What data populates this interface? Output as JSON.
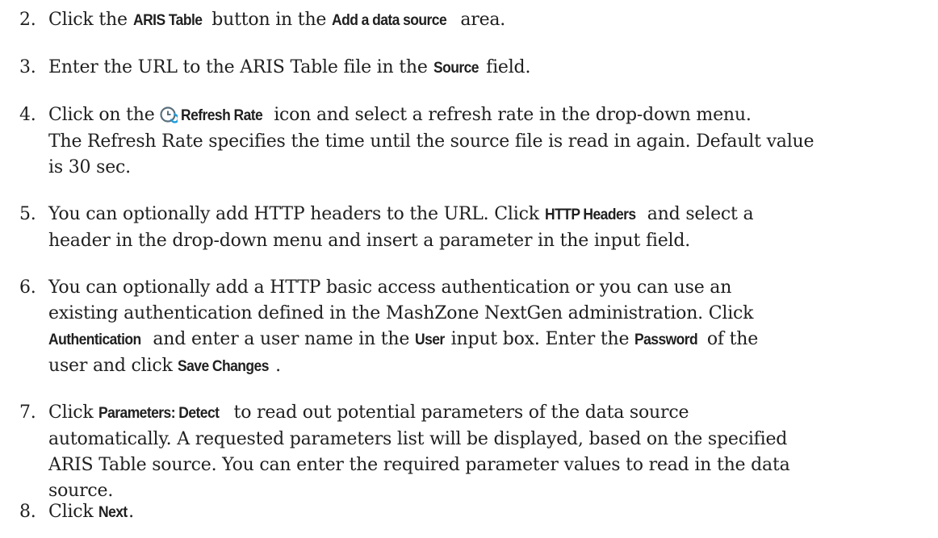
{
  "steps": [
    {
      "num": "2.",
      "parts": [
        {
          "t": "text",
          "v": "Click the "
        },
        {
          "t": "ui",
          "v": "ARIS Table"
        },
        {
          "t": "text",
          "v": " button in the "
        },
        {
          "t": "ui",
          "v": "Add a data source"
        },
        {
          "t": "text",
          "v": " area."
        }
      ]
    },
    {
      "num": "3.",
      "parts": [
        {
          "t": "text",
          "v": "Enter the URL to the ARIS Table file in the "
        },
        {
          "t": "ui",
          "v": "Source"
        },
        {
          "t": "text",
          "v": " field."
        }
      ]
    },
    {
      "num": "4.",
      "parts": [
        {
          "t": "text",
          "v": "Click on the "
        },
        {
          "t": "icon",
          "v": "refresh-rate-icon"
        },
        {
          "t": "ui",
          "v": "Refresh Rate"
        },
        {
          "t": "text",
          "v": " icon and select a refresh rate in the drop-down menu."
        },
        {
          "t": "br"
        },
        {
          "t": "text",
          "v": "The Refresh Rate specifies the time until the source file is read in again. Default value"
        },
        {
          "t": "br"
        },
        {
          "t": "text",
          "v": "is 30 sec."
        }
      ]
    },
    {
      "num": "5.",
      "parts": [
        {
          "t": "text",
          "v": "You can optionally add HTTP headers to the URL. Click "
        },
        {
          "t": "ui",
          "v": "HTTP Headers"
        },
        {
          "t": "text",
          "v": " and select a"
        },
        {
          "t": "br"
        },
        {
          "t": "text",
          "v": "header in the drop-down menu and insert a parameter in the input field."
        }
      ]
    },
    {
      "num": "6.",
      "parts": [
        {
          "t": "text",
          "v": "You can optionally add a HTTP basic access authentication or you can use an"
        },
        {
          "t": "br"
        },
        {
          "t": "text",
          "v": "existing authentication defined in the MashZone NextGen administration. Click"
        },
        {
          "t": "br"
        },
        {
          "t": "ui",
          "v": "Authentication"
        },
        {
          "t": "text",
          "v": " and enter a user name in the "
        },
        {
          "t": "ui",
          "v": "User"
        },
        {
          "t": "text",
          "v": " input box. Enter the "
        },
        {
          "t": "ui",
          "v": "Password"
        },
        {
          "t": "text",
          "v": " of the"
        },
        {
          "t": "br"
        },
        {
          "t": "text",
          "v": "user and click "
        },
        {
          "t": "ui",
          "v": "Save Changes"
        },
        {
          "t": "text",
          "v": "."
        }
      ]
    },
    {
      "num": "7.",
      "parts": [
        {
          "t": "text",
          "v": "Click "
        },
        {
          "t": "ui",
          "v": "Parameters: Detect"
        },
        {
          "t": "text",
          "v": " to read out potential parameters of the data source"
        },
        {
          "t": "br"
        },
        {
          "t": "text",
          "v": "automatically. A requested parameters list will be displayed, based on the specified"
        },
        {
          "t": "br"
        },
        {
          "t": "text",
          "v": "ARIS Table source. You can enter the required parameter values to read in the data"
        },
        {
          "t": "br"
        },
        {
          "t": "text",
          "v": "source."
        }
      ]
    },
    {
      "num": "8.",
      "parts": [
        {
          "t": "text",
          "v": "Click "
        },
        {
          "t": "ui",
          "v": "Next"
        },
        {
          "t": "text",
          "v": "."
        }
      ]
    }
  ]
}
